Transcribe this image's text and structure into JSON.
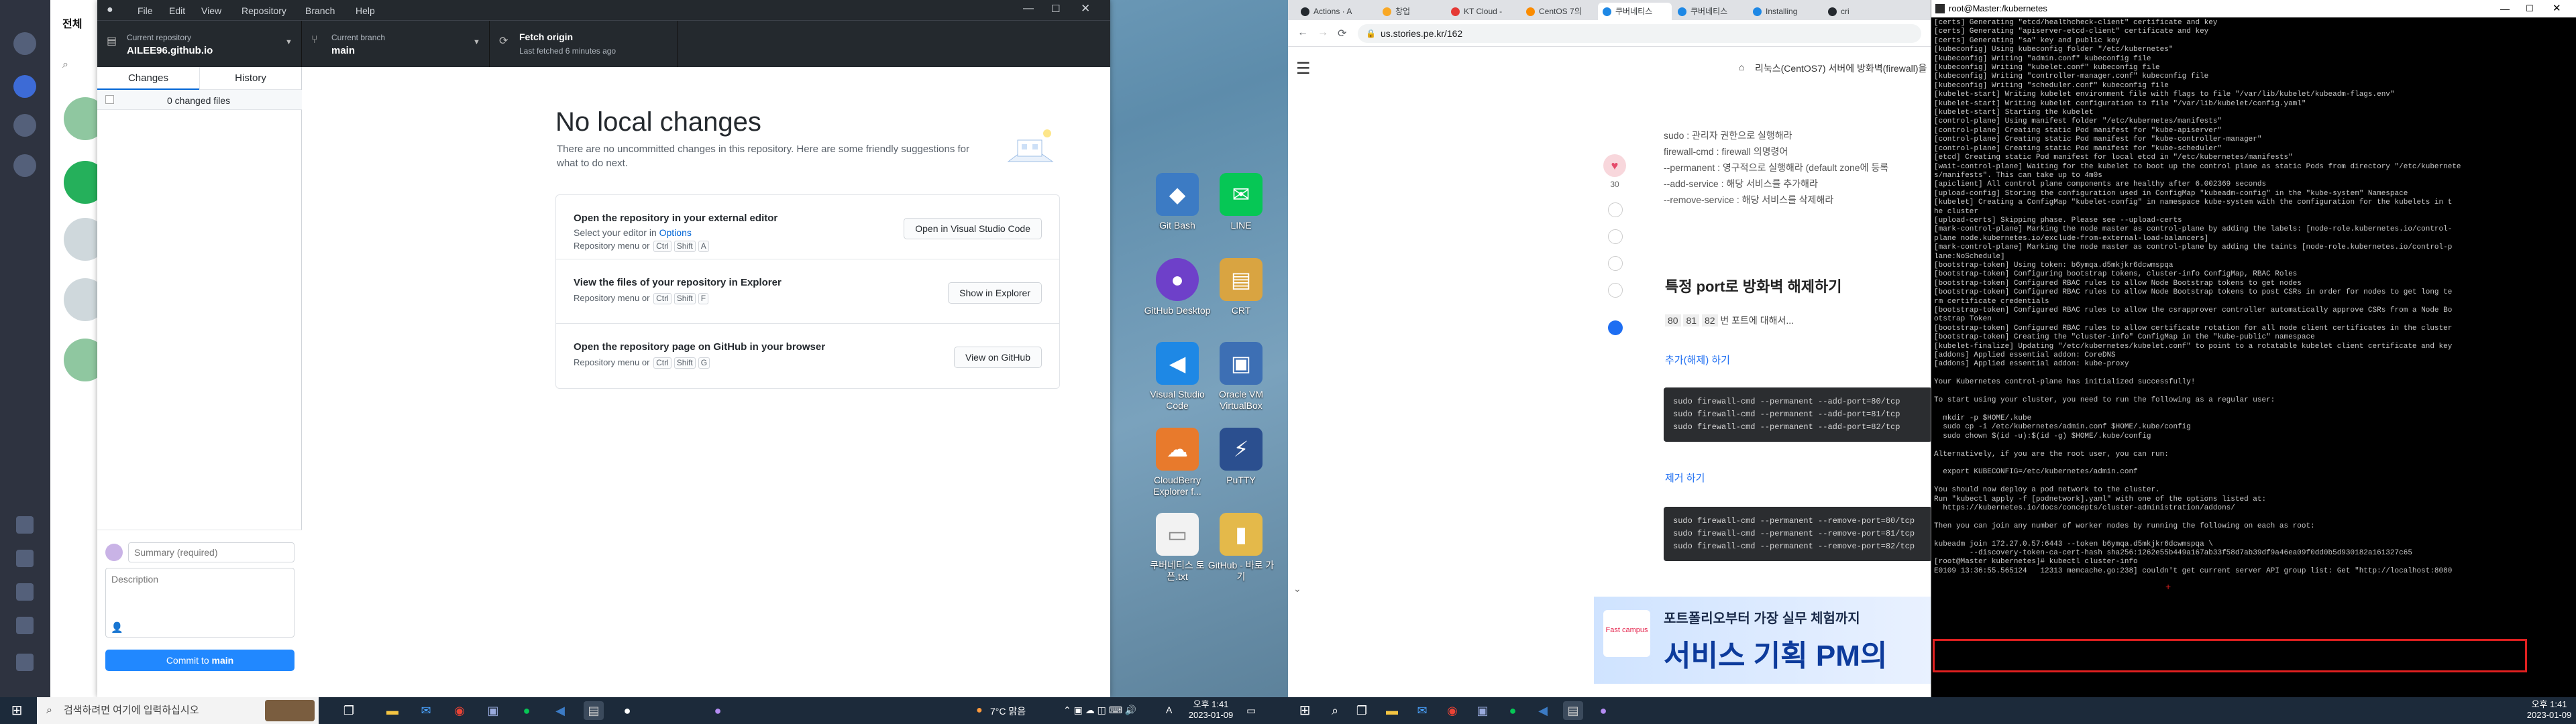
{
  "left_screen": {
    "chat_app": {
      "tab_label": "전체"
    },
    "github": {
      "menu": [
        "File",
        "Edit",
        "View",
        "Repository",
        "Branch",
        "Help"
      ],
      "toolbar": {
        "repo_caption": "Current repository",
        "repo_value": "AILEE96.github.io",
        "branch_caption": "Current branch",
        "branch_value": "main",
        "fetch_caption": "Fetch origin",
        "fetch_sub": "Last fetched 6 minutes ago"
      },
      "tabs": [
        "Changes",
        "History"
      ],
      "changed_files": "0 changed files",
      "summary_placeholder": "Summary (required)",
      "description_placeholder": "Description",
      "commit_label_prefix": "Commit to ",
      "commit_label_branch": "main",
      "heading": "No local changes",
      "subtext": "There are no uncommitted changes in this repository. Here are some friendly suggestions for what to do next.",
      "cards": [
        {
          "title": "Open the repository in your external editor",
          "sub_prefix": "Select your editor in ",
          "sub_link": "Options",
          "menu_prefix": "Repository menu or",
          "keys": [
            "Ctrl",
            "Shift",
            "A"
          ],
          "button": "Open in Visual Studio Code"
        },
        {
          "title": "View the files of your repository in Explorer",
          "sub_prefix": "",
          "sub_link": "",
          "menu_prefix": "Repository menu or",
          "keys": [
            "Ctrl",
            "Shift",
            "F"
          ],
          "button": "Show in Explorer"
        },
        {
          "title": "Open the repository page on GitHub in your browser",
          "sub_prefix": "",
          "sub_link": "",
          "menu_prefix": "Repository menu or",
          "keys": [
            "Ctrl",
            "Shift",
            "G"
          ],
          "button": "View on GitHub"
        }
      ]
    },
    "desktop_icons": [
      {
        "label": "Git Bash",
        "color": "#3c7bc4",
        "glyph": "◆"
      },
      {
        "label": "LINE",
        "color": "#06c755",
        "glyph": "✉"
      },
      {
        "label": "GitHub Desktop",
        "color": "#6e40c9",
        "glyph": "●"
      },
      {
        "label": "CRT",
        "color": "#d9a441",
        "glyph": "▤"
      },
      {
        "label": "Visual Studio Code",
        "color": "#1e88e5",
        "glyph": "◀"
      },
      {
        "label": "Oracle VM VirtualBox",
        "color": "#3d6fb4",
        "glyph": "▣"
      },
      {
        "label": "CloudBerry Explorer f...",
        "color": "#e87a2c",
        "glyph": "☁"
      },
      {
        "label": "PuTTY",
        "color": "#2b4f8f",
        "glyph": "⚡"
      },
      {
        "label": "쿠버네티스 토픈.txt",
        "color": "#f2f2f2",
        "glyph": "▭"
      },
      {
        "label": "GitHub - 바로 가기",
        "color": "#e4b94a",
        "glyph": "▮"
      }
    ],
    "taskbar": {
      "search_placeholder": "검색하려면 여기에 입력하십시오",
      "weather": "7°C 맑음",
      "ime": "A",
      "time": "오후 1:41",
      "date": "2023-01-09"
    }
  },
  "right_screen": {
    "chrome": {
      "tabs": [
        "Actions · A",
        "창업",
        "KT Cloud -",
        "CentOS 7의",
        "쿠버네티스",
        "쿠버네티스",
        "Installing",
        "cri"
      ],
      "url": "us.stories.pe.kr/162",
      "breadcrumb": "리눅스(CentOS7) 서버에 방화벽(firewall)을",
      "like_count": "30",
      "side_text": [
        "sudo : 관리자 권한으로 실행해라",
        "firewall-cmd : firewall 의명령어",
        "--permanent : 영구적으로 실행해라 (default zone에 등록",
        "--add-service : 해당 서비스를 추가해라",
        "--remove-service : 해당 서비스를 삭제해라"
      ],
      "section_title": "특정 port로 방화벽 해제하기",
      "port_chips": [
        "80",
        "81",
        "82"
      ],
      "port_text": "번 포트에 대해서...",
      "add_heading": "추가(해제) 하기",
      "add_code": "sudo firewall-cmd --permanent --add-port=80/tcp\nsudo firewall-cmd --permanent --add-port=81/tcp\nsudo firewall-cmd --permanent --add-port=82/tcp",
      "remove_heading": "제거 하기",
      "remove_code": "sudo firewall-cmd --permanent --remove-port=80/tcp\nsudo firewall-cmd --permanent --remove-port=81/tcp\nsudo firewall-cmd --permanent --remove-port=82/tcp",
      "ad_brand": "Fast campus",
      "ad_line1": "포트폴리오부터 가장 실무 체험까지",
      "ad_line2": "서비스 기획 PM의"
    },
    "terminal": {
      "title": "root@Master:/kubernetes",
      "lines": [
        "[certs] Generating \"etcd/healthcheck-client\" certificate and key",
        "[certs] Generating \"apiserver-etcd-client\" certificate and key",
        "[certs] Generating \"sa\" key and public key",
        "[kubeconfig] Using kubeconfig folder \"/etc/kubernetes\"",
        "[kubeconfig] Writing \"admin.conf\" kubeconfig file",
        "[kubeconfig] Writing \"kubelet.conf\" kubeconfig file",
        "[kubeconfig] Writing \"controller-manager.conf\" kubeconfig file",
        "[kubeconfig] Writing \"scheduler.conf\" kubeconfig file",
        "[kubelet-start] Writing kubelet environment file with flags to file \"/var/lib/kubelet/kubeadm-flags.env\"",
        "[kubelet-start] Writing kubelet configuration to file \"/var/lib/kubelet/config.yaml\"",
        "[kubelet-start] Starting the kubelet",
        "[control-plane] Using manifest folder \"/etc/kubernetes/manifests\"",
        "[control-plane] Creating static Pod manifest for \"kube-apiserver\"",
        "[control-plane] Creating static Pod manifest for \"kube-controller-manager\"",
        "[control-plane] Creating static Pod manifest for \"kube-scheduler\"",
        "[etcd] Creating static Pod manifest for local etcd in \"/etc/kubernetes/manifests\"",
        "[wait-control-plane] Waiting for the kubelet to boot up the control plane as static Pods from directory \"/etc/kubernete",
        "s/manifests\". This can take up to 4m0s",
        "[apiclient] All control plane components are healthy after 6.002369 seconds",
        "[upload-config] Storing the configuration used in ConfigMap \"kubeadm-config\" in the \"kube-system\" Namespace",
        "[kubelet] Creating a ConfigMap \"kubelet-config\" in namespace kube-system with the configuration for the kubelets in t",
        "he cluster",
        "[upload-certs] Skipping phase. Please see --upload-certs",
        "[mark-control-plane] Marking the node master as control-plane by adding the labels: [node-role.kubernetes.io/control-",
        "plane node.kubernetes.io/exclude-from-external-load-balancers]",
        "[mark-control-plane] Marking the node master as control-plane by adding the taints [node-role.kubernetes.io/control-p",
        "lane:NoSchedule]",
        "[bootstrap-token] Using token: b6ymqa.d5mkjkr6dcwmspqa",
        "[bootstrap-token] Configuring bootstrap tokens, cluster-info ConfigMap, RBAC Roles",
        "[bootstrap-token] Configured RBAC rules to allow Node Bootstrap tokens to get nodes",
        "[bootstrap-token] Configured RBAC rules to allow Node Bootstrap tokens to post CSRs in order for nodes to get long te",
        "rm certificate credentials",
        "[bootstrap-token] Configured RBAC rules to allow the csrapprover controller automatically approve CSRs from a Node Bo",
        "otstrap Token",
        "[bootstrap-token] Configured RBAC rules to allow certificate rotation for all node client certificates in the cluster",
        "[bootstrap-token] Creating the \"cluster-info\" ConfigMap in the \"kube-public\" namespace",
        "[kubelet-finalize] Updating \"/etc/kubernetes/kubelet.conf\" to point to a rotatable kubelet client certificate and key",
        "[addons] Applied essential addon: CoreDNS",
        "[addons] Applied essential addon: kube-proxy",
        "",
        "Your Kubernetes control-plane has initialized successfully!",
        "",
        "To start using your cluster, you need to run the following as a regular user:",
        "",
        "  mkdir -p $HOME/.kube",
        "  sudo cp -i /etc/kubernetes/admin.conf $HOME/.kube/config",
        "  sudo chown $(id -u):$(id -g) $HOME/.kube/config",
        "",
        "Alternatively, if you are the root user, you can run:",
        "",
        "  export KUBECONFIG=/etc/kubernetes/admin.conf",
        "",
        "You should now deploy a pod network to the cluster.",
        "Run \"kubectl apply -f [podnetwork].yaml\" with one of the options listed at:",
        "  https://kubernetes.io/docs/concepts/cluster-administration/addons/",
        "",
        "Then you can join any number of worker nodes by running the following on each as root:",
        "",
        "kubeadm join 172.27.0.57:6443 --token b6ymqa.d5mkjkr6dcwmspqa \\",
        "        --discovery-token-ca-cert-hash sha256:1262e55b449a167ab33f58d7ab39df9a46ea09f0dd0b5d930182a161327c65",
        "[root@Master kubernetes]# kubectl cluster-info",
        "E0109 13:36:55.565124   12313 memcache.go:238] couldn't get current server API group list: Get \"http://localhost:8080"
      ]
    },
    "taskbar": {
      "time": "오후 1:41",
      "date": "2023-01-09"
    }
  }
}
